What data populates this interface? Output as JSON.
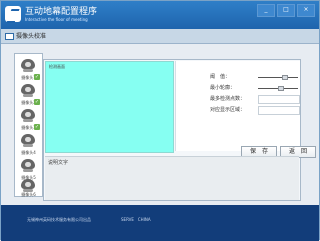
{
  "window": {
    "title": "互动地幕配置程序",
    "subtitle": "Interactive the floor of meeting",
    "buttons": [
      "_",
      "□",
      "×"
    ]
  },
  "tab": {
    "label": "摄像头校准"
  },
  "cameras": [
    {
      "label": "摄像头1"
    },
    {
      "label": "摄像头2"
    },
    {
      "label": "摄像头3"
    },
    {
      "label": "摄像头4"
    },
    {
      "label": "摄像头5"
    },
    {
      "label": "摄像头6"
    }
  ],
  "video": {
    "label": "检测画面"
  },
  "settings": {
    "brightness_label": "阈　值：",
    "sensitivity_label": "最小轮廓：",
    "max_detection_label": "最多检测点数：",
    "detection_area_label": "对应显示区域："
  },
  "sliders": {
    "brightness_level": 0.6,
    "sensitivity_level": 0.5
  },
  "buttons": {
    "save": "保　存",
    "back": "返　回"
  },
  "description": {
    "label": "说明文字"
  },
  "footer": {
    "left": "无锡神州英码技术服务有限公司出品",
    "right": "SERVE　CHINA"
  }
}
